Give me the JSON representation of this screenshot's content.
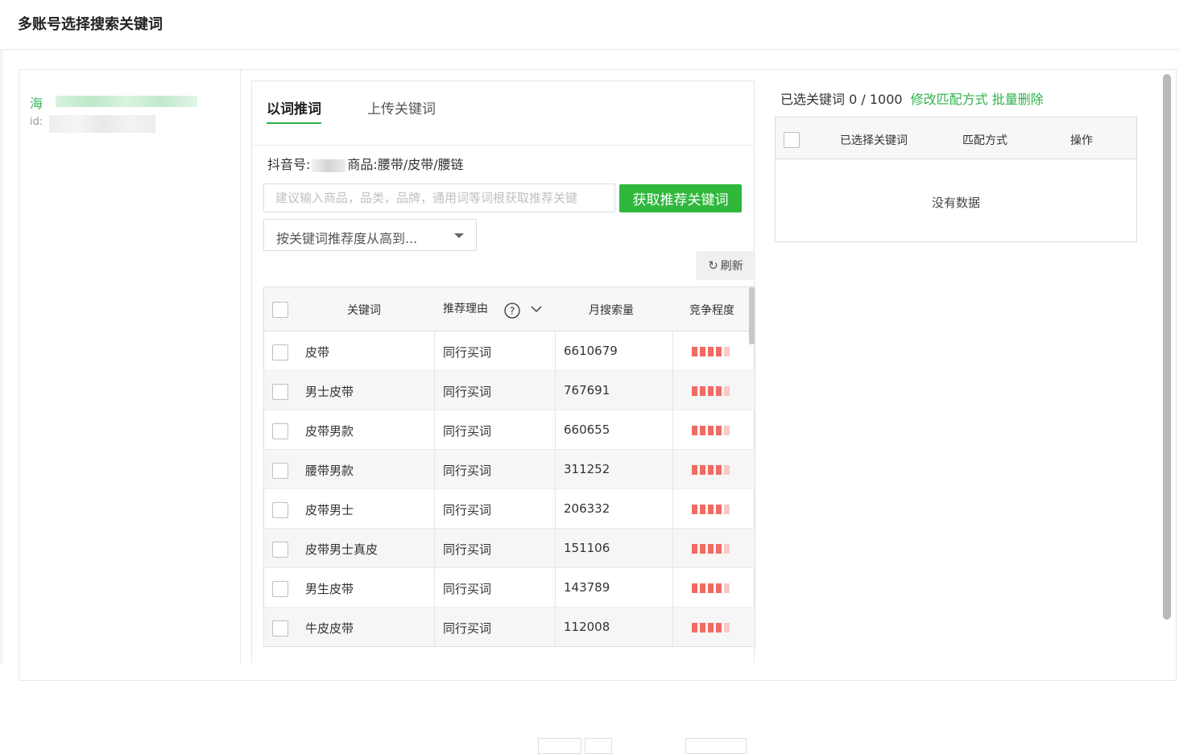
{
  "page": {
    "title": "多账号选择搜索关键词"
  },
  "account": {
    "name": "海",
    "id_label": "id:"
  },
  "tabs": [
    {
      "label": "以词推词",
      "active": true
    },
    {
      "label": "上传关键词",
      "active": false
    }
  ],
  "info": {
    "douyin_label": "抖音号:",
    "product_label": "商品:",
    "product": "腰带/皮带/腰链"
  },
  "search": {
    "placeholder": "建议输入商品，品类，品牌，通用词等词根获取推荐关键",
    "button": "获取推荐关键词"
  },
  "sort": {
    "selected": "按关键词推荐度从高到..."
  },
  "refresh": {
    "label": "刷新"
  },
  "table": {
    "headers": {
      "keyword": "关键词",
      "reason": "推荐理由",
      "monthly": "月搜索量",
      "competition": "竞争程度"
    },
    "rows": [
      {
        "keyword": "皮带",
        "reason": "同行买词",
        "monthly": "6610679",
        "level": 4
      },
      {
        "keyword": "男士皮带",
        "reason": "同行买词",
        "monthly": "767691",
        "level": 4
      },
      {
        "keyword": "皮带男款",
        "reason": "同行买词",
        "monthly": "660655",
        "level": 4
      },
      {
        "keyword": "腰带男款",
        "reason": "同行买词",
        "monthly": "311252",
        "level": 4
      },
      {
        "keyword": "皮带男士",
        "reason": "同行买词",
        "monthly": "206332",
        "level": 4
      },
      {
        "keyword": "皮带男士真皮",
        "reason": "同行买词",
        "monthly": "151106",
        "level": 4
      },
      {
        "keyword": "男生皮带",
        "reason": "同行买词",
        "monthly": "143789",
        "level": 4
      },
      {
        "keyword": "牛皮皮带",
        "reason": "同行买词",
        "monthly": "112008",
        "level": 4
      }
    ]
  },
  "selected": {
    "label": "已选关键词",
    "count": "0 / 1000",
    "modify_link": "修改匹配方式",
    "delete_link": "批量删除",
    "headers": {
      "keyword": "已选择关键词",
      "match": "匹配方式",
      "action": "操作"
    },
    "empty": "没有数据"
  },
  "colors": {
    "accent": "#2fb34a",
    "bar_full": "#f26b62",
    "bar_light": "#f9c9c5"
  }
}
